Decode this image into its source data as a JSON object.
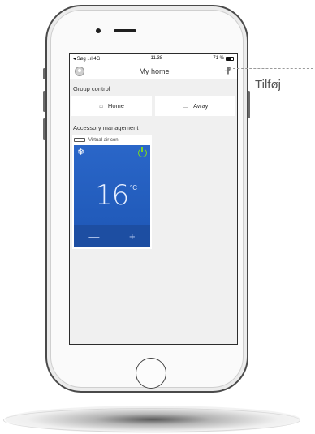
{
  "status_bar": {
    "carrier": "◂ Søg ..ıl 4G",
    "time": "11.38",
    "battery": "71 %"
  },
  "nav": {
    "title": "My home",
    "add_symbol": "+"
  },
  "group_control": {
    "label": "Group control",
    "buttons": [
      {
        "icon": "home-icon",
        "label": "Home"
      },
      {
        "icon": "away-icon",
        "label": "Away"
      }
    ]
  },
  "accessory": {
    "label": "Accessory management",
    "card": {
      "name": "Virtual air con",
      "mode_icon": "snowflake-icon",
      "power_icon": "power-icon",
      "temperature": "16",
      "unit": "°C",
      "minus": "—",
      "plus": "+"
    }
  },
  "callout": {
    "label": "Tilføj"
  },
  "colors": {
    "card_blue": "#2a66c8",
    "card_blue_dark": "#1d4ea2",
    "power_green": "#79d32a"
  }
}
